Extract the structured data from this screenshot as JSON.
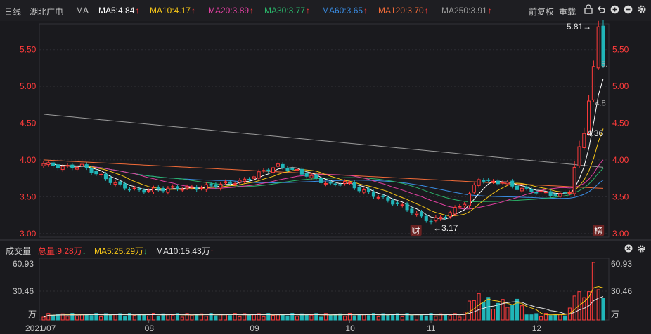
{
  "header": {
    "period_label": "日线",
    "stock_name": "湖北广电",
    "ma_label": "MA",
    "ma_items": [
      {
        "label": "MA5:4.84",
        "color": "#ffffff",
        "trend": "↑"
      },
      {
        "label": "MA10:4.17",
        "color": "#f5c518",
        "trend": "↑"
      },
      {
        "label": "MA20:3.89",
        "color": "#e040a0",
        "trend": "↑"
      },
      {
        "label": "MA30:3.77",
        "color": "#2bb56a",
        "trend": "↑"
      },
      {
        "label": "MA60:3.65",
        "color": "#3a8ee6",
        "trend": "↑"
      },
      {
        "label": "MA120:3.70",
        "color": "#f26b38",
        "trend": "↑"
      },
      {
        "label": "MA250:3.91",
        "color": "#9a9a9a",
        "trend": "↑"
      }
    ],
    "adjust_label": "前复权",
    "reset_label": "重载",
    "icons": [
      "lock-icon",
      "undo-icon",
      "zoom-in-icon",
      "zoom-out-icon",
      "settings-icon"
    ]
  },
  "volume_header": {
    "title": "成交量",
    "total": "总量:9.28万",
    "total_trend": "↓",
    "ma5": "MA5:25.29万",
    "ma5_trend": "↓",
    "ma10": "MA10:15.43万",
    "ma10_trend": "↑"
  },
  "colors": {
    "up": "#ff3b3b",
    "down": "#20b5b8",
    "ma5": "#ffffff",
    "ma10": "#f5c518",
    "ma20": "#e040a0",
    "ma30": "#2bb56a",
    "ma60": "#3a8ee6",
    "ma120": "#f26b38",
    "ma250": "#9a9a9a"
  },
  "chart_data": [
    {
      "type": "candlestick",
      "title": "",
      "y_ticks": [
        "5.50",
        "5.00",
        "4.50",
        "4.00",
        "3.50",
        "3.00"
      ],
      "y_tick_values": [
        5.5,
        5.0,
        4.5,
        4.0,
        3.5,
        3.0
      ],
      "ylim": [
        2.95,
        5.85
      ],
      "x_ticks": [
        "2021/07",
        "08",
        "09",
        "10",
        "11",
        "12"
      ],
      "x_tick_index": [
        0,
        22,
        44,
        64,
        81,
        103
      ],
      "n_candles": 118,
      "annotations": {
        "high_label": "5.81→",
        "low_label": "←3.17",
        "last_price_label": "4.36",
        "ma_end_label": "4.8",
        "partial_label": "5.",
        "event_markers": [
          "财",
          "榜"
        ]
      },
      "key_points": {
        "high": 5.81,
        "low": 3.17,
        "last_close": 4.36
      },
      "grid": true
    },
    {
      "type": "bar",
      "title": "",
      "y_ticks": [
        "60.93",
        "30.46",
        "万"
      ],
      "y_tick_values": [
        60.93,
        30.46,
        0
      ],
      "unit": "万",
      "ylim": [
        0,
        60.93
      ],
      "max_volume": 60.93
    }
  ]
}
